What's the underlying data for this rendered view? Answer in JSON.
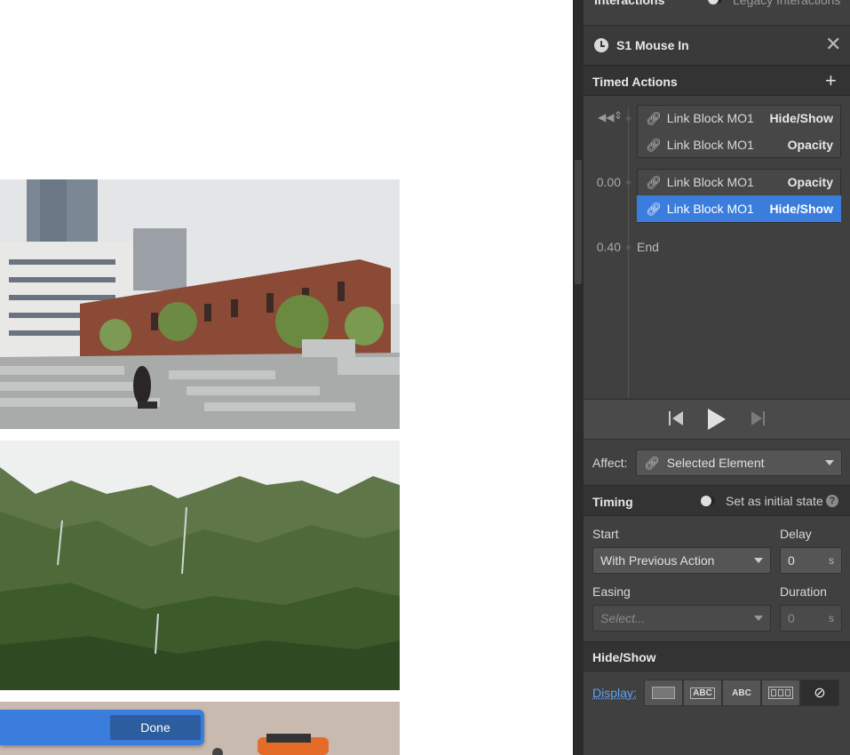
{
  "canvas": {
    "done_label": "Done"
  },
  "panel": {
    "top_title": "Interactions",
    "legacy_label": "Legacy Interactions",
    "trigger_title": "S1 Mouse In",
    "timed_actions_title": "Timed Actions",
    "groups": [
      {
        "time": "",
        "items": [
          {
            "name": "Link Block MO1",
            "action": "Hide/Show",
            "selected": false
          },
          {
            "name": "Link Block MO1",
            "action": "Opacity",
            "selected": false
          }
        ]
      },
      {
        "time": "0.00",
        "items": [
          {
            "name": "Link Block MO1",
            "action": "Opacity",
            "selected": false
          },
          {
            "name": "Link Block MO1",
            "action": "Hide/Show",
            "selected": true
          }
        ]
      }
    ],
    "end_time": "0.40",
    "end_label": "End",
    "affect_label": "Affect:",
    "affect_value": "Selected Element",
    "timing_title": "Timing",
    "initial_state_label": "Set as initial state",
    "start_label": "Start",
    "start_value": "With Previous Action",
    "delay_label": "Delay",
    "delay_value": "0",
    "delay_unit": "s",
    "easing_label": "Easing",
    "easing_placeholder": "Select...",
    "duration_label": "Duration",
    "duration_value": "0",
    "duration_unit": "s",
    "hideshow_title": "Hide/Show",
    "display_label": "Display:",
    "display_options": [
      "block",
      "ABC",
      "ABC",
      "flex",
      "none"
    ]
  },
  "colors": {
    "accent": "#3b7ddd",
    "panel_bg": "#404040",
    "header_bg": "#333333"
  }
}
